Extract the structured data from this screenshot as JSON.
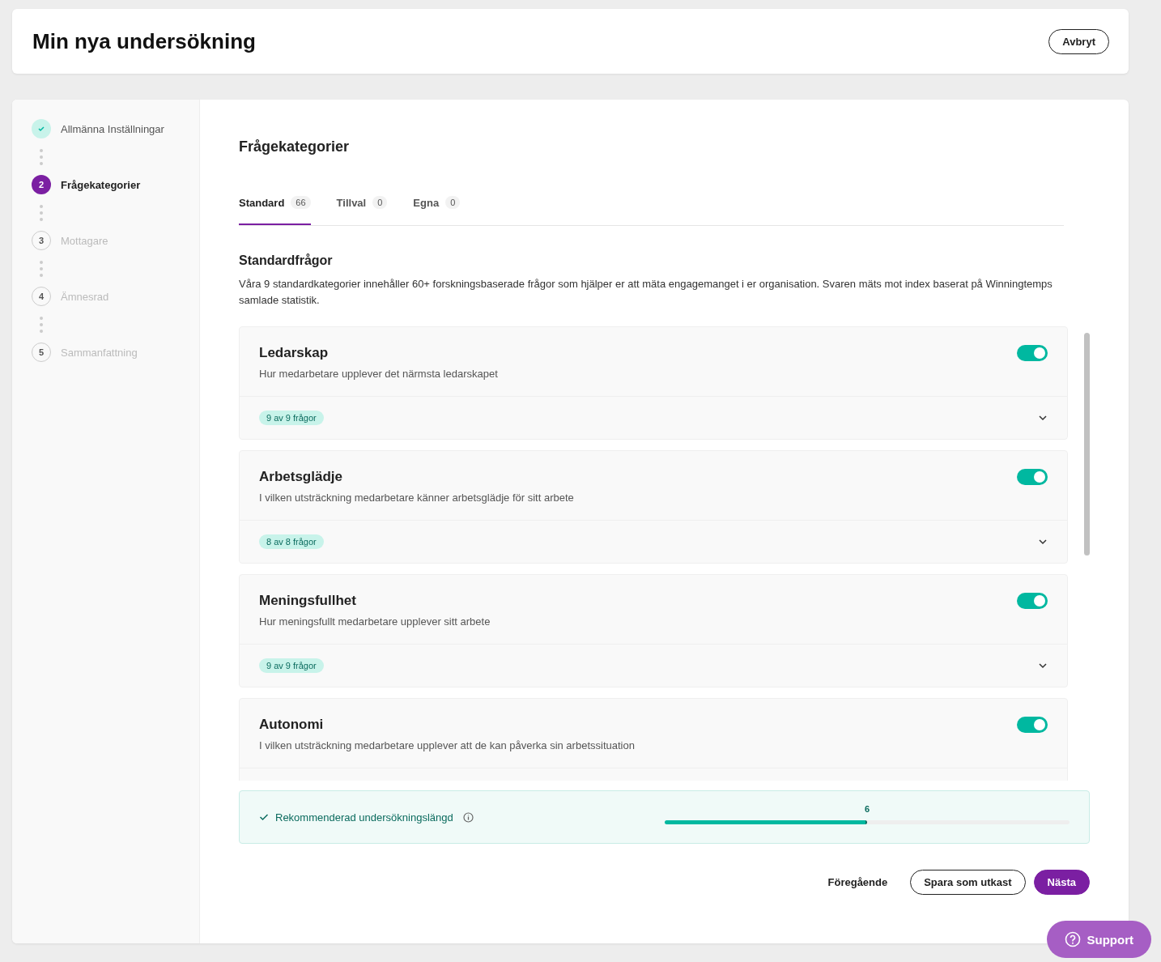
{
  "header": {
    "title": "Min nya undersökning",
    "cancel_button": "Avbryt"
  },
  "steps": [
    {
      "label": "Allmänna Inställningar",
      "completed": true,
      "selected": false
    },
    {
      "number": "2",
      "label": "Frågekategorier",
      "completed": false,
      "selected": true
    },
    {
      "number": "3",
      "label": "Mottagare",
      "completed": false,
      "selected": false
    },
    {
      "number": "4",
      "label": "Ämnesrad",
      "completed": false,
      "selected": false
    },
    {
      "number": "5",
      "label": "Sammanfattning",
      "completed": false,
      "selected": false
    }
  ],
  "page_title": "Frågekategorier",
  "tabs": [
    {
      "label": "Standard",
      "count": "66",
      "selected": true
    },
    {
      "label": "Tillval",
      "count": "0",
      "selected": false
    },
    {
      "label": "Egna",
      "count": "0",
      "selected": false
    }
  ],
  "section": {
    "title": "Standardfrågor",
    "description": "Våra 9 standardkategorier innehåller 60+ forskningsbaserade frågor som hjälper er att mäta engagemanget i er organisation. Svaren mäts mot index baserat på Winningtemps samlade statistik."
  },
  "categories": [
    {
      "title": "Ledarskap",
      "description": "Hur medarbetare upplever det närmsta ledarskapet",
      "on": true,
      "badge": "9 av 9 frågor"
    },
    {
      "title": "Arbetsglädje",
      "description": "I vilken utsträckning medarbetare känner arbetsglädje för sitt arbete",
      "on": true,
      "badge": "8 av 8 frågor"
    },
    {
      "title": "Meningsfullhet",
      "description": "Hur meningsfullt medarbetare upplever sitt arbete",
      "on": true,
      "badge": "9 av 9 frågor"
    },
    {
      "title": "Autonomi",
      "description": "I vilken utsträckning medarbetare upplever att de kan påverka sin arbetssituation",
      "on": true
    }
  ],
  "recommendation": {
    "label": "Rekommenderad undersökningslängd",
    "reading": "6",
    "level": 0.5
  },
  "footer": {
    "previous": "Föregående",
    "save_draft": "Spara som utkast",
    "next": "Nästa"
  },
  "support_button": "Support"
}
